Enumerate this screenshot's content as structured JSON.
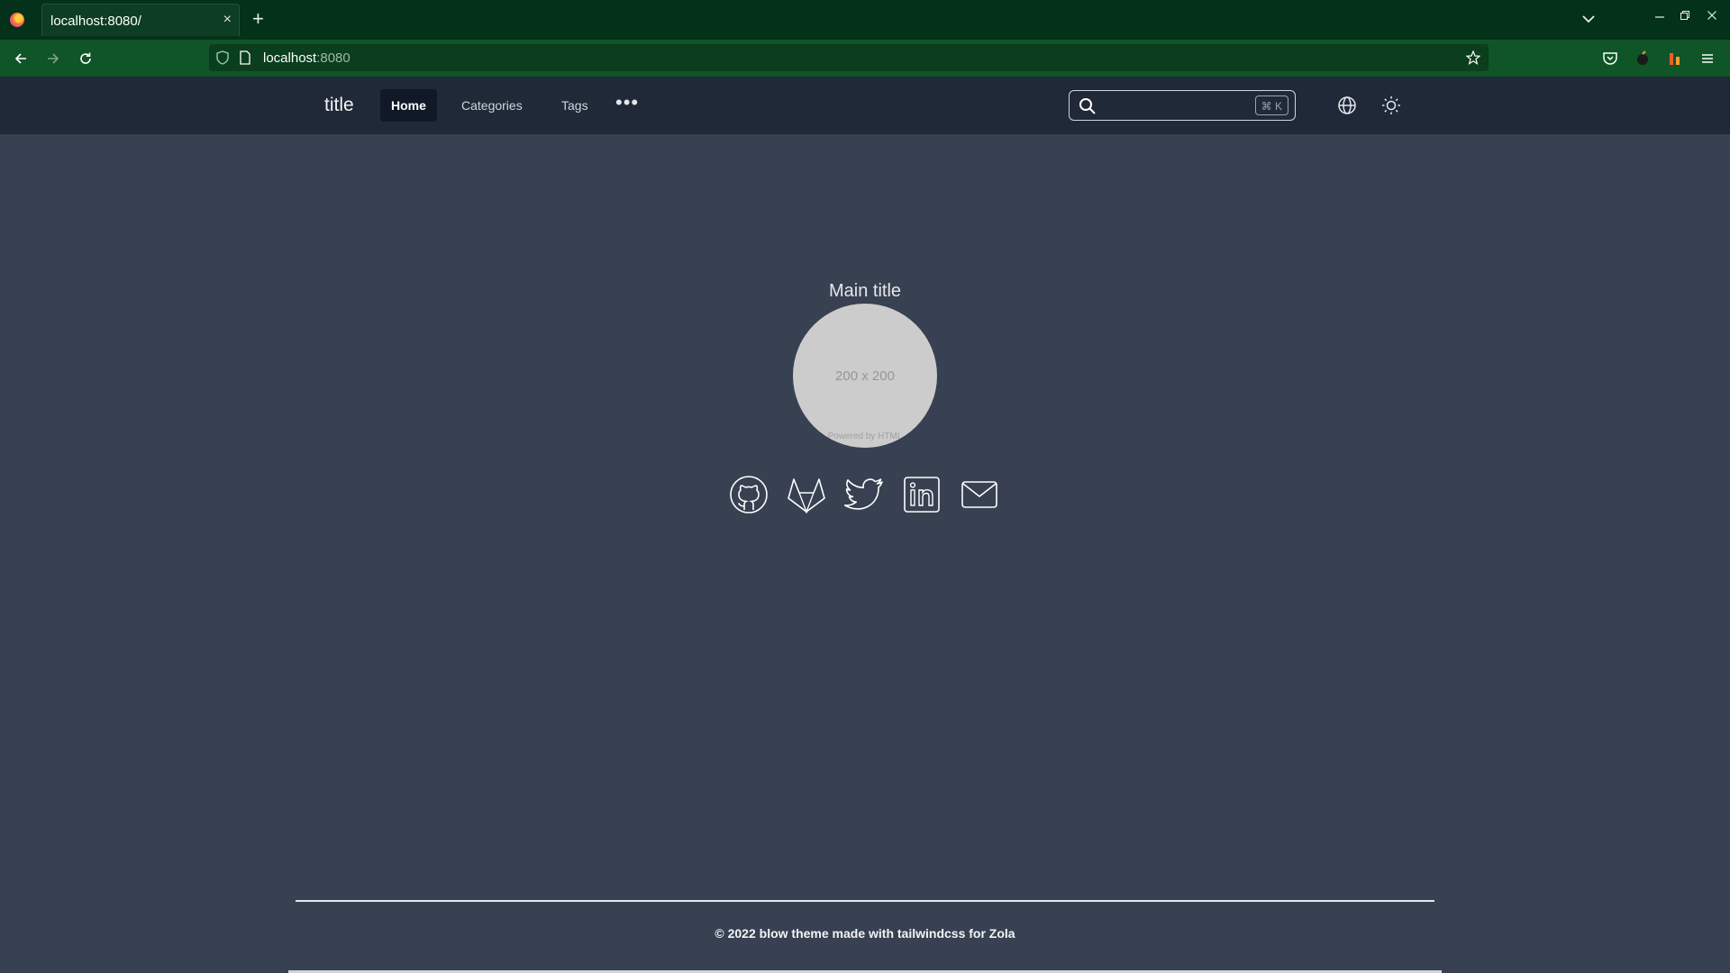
{
  "browser": {
    "tab_title": "localhost:8080/",
    "tab_close": "×",
    "new_tab": "+",
    "url_host": "localhost",
    "url_port": ":8080"
  },
  "header": {
    "site_title": "title",
    "nav": [
      {
        "label": "Home",
        "active": true
      },
      {
        "label": "Categories",
        "active": false
      },
      {
        "label": "Tags",
        "active": false
      }
    ],
    "more": "•••",
    "search": {
      "placeholder": "",
      "shortcut": "⌘ K"
    }
  },
  "main": {
    "title": "Main title",
    "avatar_text": "200 x 200",
    "avatar_subtext": "Powered by HTML",
    "social": [
      "github-icon",
      "gitlab-icon",
      "twitter-icon",
      "linkedin-icon",
      "email-icon"
    ]
  },
  "footer": {
    "text": "© 2022 blow theme made with tailwindcss for Zola"
  },
  "colors": {
    "page_bg": "#374151",
    "header_bg": "#1f2937",
    "active_nav_bg": "#111827",
    "browser_tabbar": "#043119",
    "browser_navbar": "#0f5528"
  }
}
